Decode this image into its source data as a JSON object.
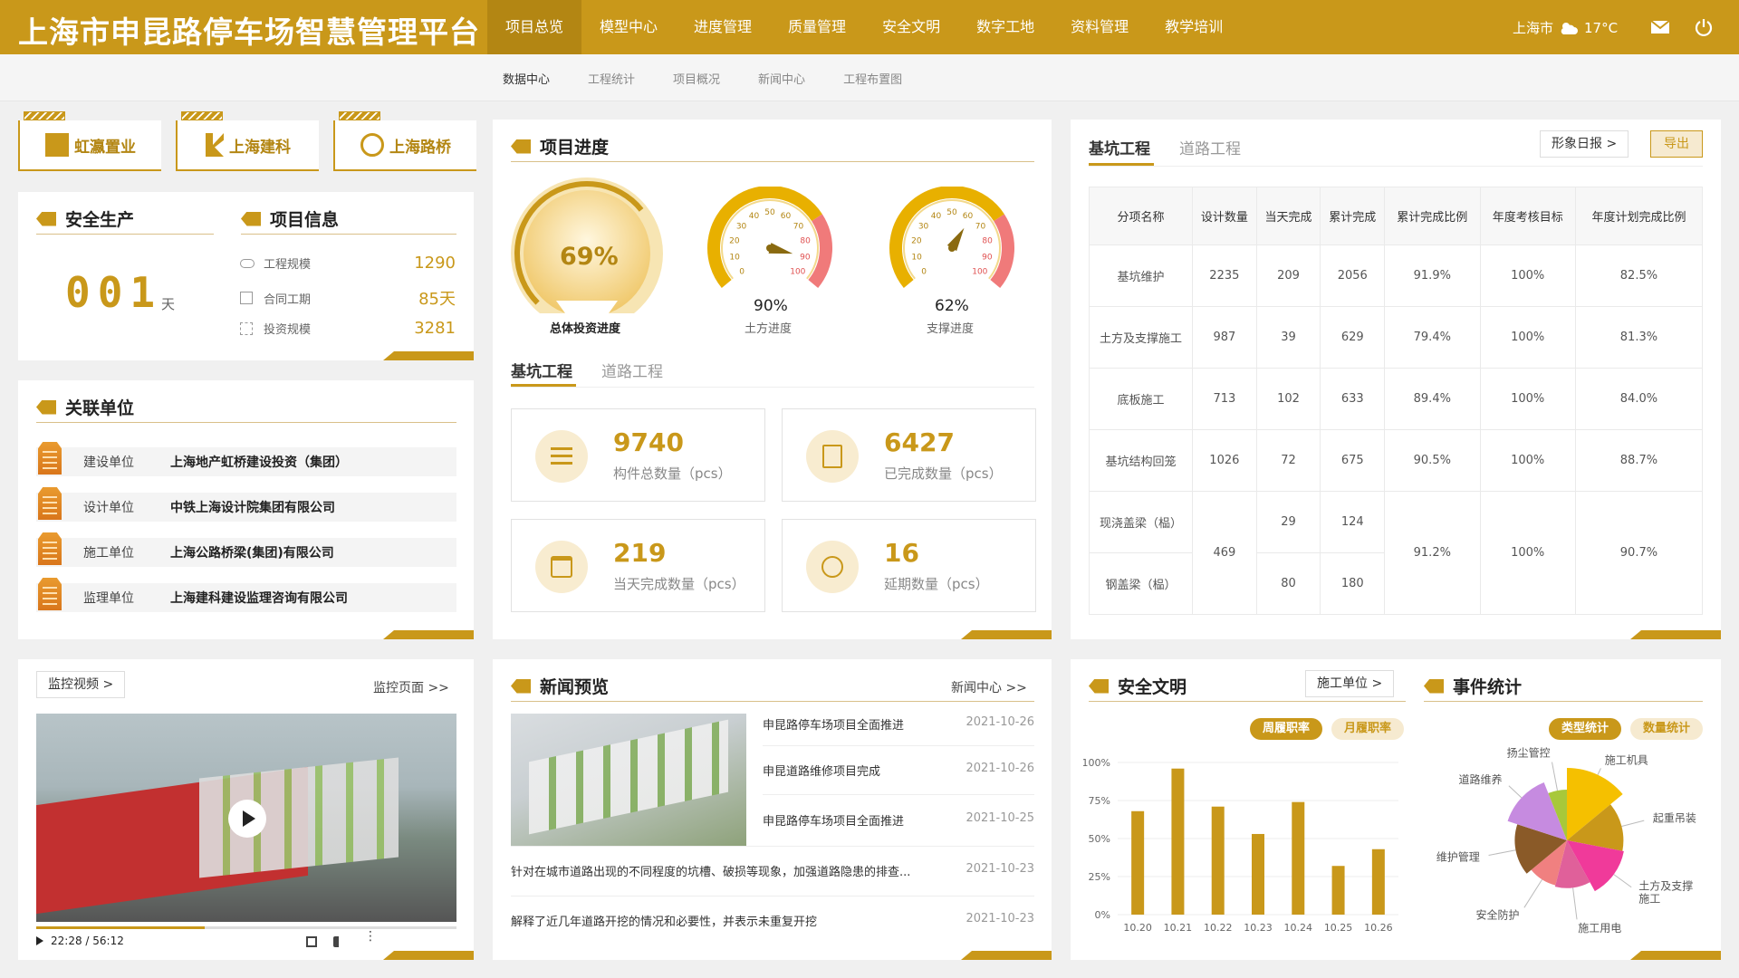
{
  "header": {
    "title": "上海市申昆路停车场智慧管理平台",
    "nav": [
      "项目总览",
      "模型中心",
      "进度管理",
      "质量管理",
      "安全文明",
      "数字工地",
      "资料管理",
      "教学培训"
    ],
    "city": "上海市",
    "temp": "17°C"
  },
  "subnav": [
    "数据中心",
    "工程统计",
    "项目概况",
    "新闻中心",
    "工程布置图"
  ],
  "logos": [
    "虹瀛置业",
    "上海建科",
    "上海路桥"
  ],
  "safety": {
    "title": "安全生产",
    "days": "001",
    "unit": "天"
  },
  "project_info": {
    "title": "项目信息",
    "rows": [
      {
        "label": "工程规模",
        "value": "1290"
      },
      {
        "label": "合同工期",
        "value": "85天"
      },
      {
        "label": "投资规模",
        "value": "3281"
      }
    ]
  },
  "units": {
    "title": "关联单位",
    "rows": [
      {
        "label": "建设单位",
        "value": "上海地产虹桥建设投资（集团）"
      },
      {
        "label": "设计单位",
        "value": "中铁上海设计院集团有限公司"
      },
      {
        "label": "施工单位",
        "value": "上海公路桥梁(集团)有限公司"
      },
      {
        "label": "监理单位",
        "value": "上海建科建设监理咨询有限公司"
      }
    ]
  },
  "video": {
    "btn": "监控视频  >",
    "link": "监控页面  >>",
    "time": "22:28 / 56:12",
    "progress": 0.4
  },
  "progress": {
    "title": "项目进度",
    "main": {
      "value": "69%",
      "label": "总体投资进度",
      "fraction": 0.69
    },
    "gauges": [
      {
        "value": "90%",
        "label": "土方进度",
        "fraction": 0.9
      },
      {
        "value": "62%",
        "label": "支撑进度",
        "fraction": 0.62
      }
    ],
    "gauge_ticks": [
      "0",
      "10",
      "20",
      "30",
      "40",
      "50",
      "60",
      "70",
      "80",
      "90",
      "100"
    ],
    "tabs": [
      "基坑工程",
      "道路工程"
    ],
    "cards": [
      {
        "num": "9740",
        "label": "构件总数量（pcs）"
      },
      {
        "num": "6427",
        "label": "已完成数量（pcs）"
      },
      {
        "num": "219",
        "label": "当天完成数量（pcs）"
      },
      {
        "num": "16",
        "label": "延期数量（pcs）"
      }
    ]
  },
  "table": {
    "tabs": [
      "基坑工程",
      "道路工程"
    ],
    "btn_report": "形象日报  >",
    "btn_export": "导出",
    "headers": [
      "分项名称",
      "设计数量",
      "当天完成",
      "累计完成",
      "累计完成比例",
      "年度考核目标",
      "年度计划完成比例"
    ],
    "rows": [
      [
        "基坑维护",
        "2235",
        "209",
        "2056",
        "91.9%",
        "100%",
        "82.5%"
      ],
      [
        "土方及支撑施工",
        "987",
        "39",
        "629",
        "79.4%",
        "100%",
        "81.3%"
      ],
      [
        "底板施工",
        "713",
        "102",
        "633",
        "89.4%",
        "100%",
        "84.0%"
      ],
      [
        "基坑结构回笼",
        "1026",
        "72",
        "675",
        "90.5%",
        "100%",
        "88.7%"
      ]
    ],
    "merged": {
      "name1": "现浇盖梁（榀）",
      "name2": "钢盖梁（榀）",
      "design": "469",
      "today1": "29",
      "cum1": "124",
      "today2": "80",
      "cum2": "180",
      "ratio": "91.2%",
      "target": "100%",
      "plan": "90.7%"
    }
  },
  "news": {
    "title": "新闻预览",
    "link": "新闻中心  >>",
    "items": [
      {
        "text": "申昆路停车场项目全面推进",
        "date": "2021-10-26"
      },
      {
        "text": "申昆道路维修项目完成",
        "date": "2021-10-26"
      },
      {
        "text": "申昆路停车场项目全面推进",
        "date": "2021-10-25"
      },
      {
        "text": "针对在城市道路出现的不同程度的坑槽、破损等现象，加强道路隐患的排查...",
        "date": "2021-10-23"
      },
      {
        "text": "解释了近几年道路开挖的情况和必要性，并表示未重复开挖",
        "date": "2021-10-23"
      }
    ]
  },
  "safety_civil": {
    "title": "安全文明",
    "btn": "施工单位  >",
    "pills": [
      "周履职率",
      "月履职率"
    ],
    "chart_data": {
      "type": "bar",
      "categories": [
        "10.20",
        "10.21",
        "10.22",
        "10.23",
        "10.24",
        "10.25",
        "10.26"
      ],
      "values": [
        68,
        96,
        71,
        53,
        74,
        32,
        43
      ],
      "yticks": [
        "0%",
        "25%",
        "50%",
        "75%",
        "100%"
      ],
      "ylim": [
        0,
        100
      ],
      "color": "#c9981a"
    }
  },
  "events": {
    "title": "事件统计",
    "pills": [
      "类型统计",
      "数量统计"
    ],
    "chart_data": {
      "type": "pie",
      "labels": [
        "施工机具",
        "起重吊装",
        "土方及支撑施工",
        "施工用电",
        "安全防护",
        "维护管理",
        "道路维养",
        "扬尘管控"
      ],
      "values": [
        14,
        14,
        14,
        12,
        10,
        16,
        14,
        6
      ],
      "radii": [
        1.0,
        0.78,
        0.8,
        0.66,
        0.64,
        0.72,
        0.86,
        0.7
      ],
      "colors": [
        "#f5c000",
        "#c9981a",
        "#f03a9a",
        "#e0609a",
        "#f08080",
        "#8a5a28",
        "#c68be0",
        "#a8c83a"
      ]
    }
  }
}
